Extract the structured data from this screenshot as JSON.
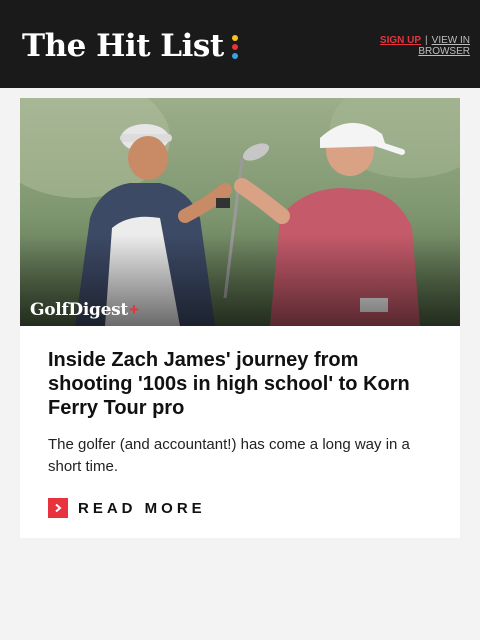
{
  "header": {
    "logo_text": "The Hit List",
    "logo_dot_colors": [
      "#f5c518",
      "#e8333e",
      "#3aa0e8"
    ],
    "signup_label": "SIGN UP",
    "separator": "|",
    "view_in_browser_label": "VIEW IN BROWSER"
  },
  "article": {
    "image_alt": "Golfer and caddie fist-bumping on the course",
    "image_brand": "GolfDigest",
    "image_brand_plus": "+",
    "headline": "Inside Zach James' journey from shooting '100s in high school' to Korn Ferry Tour pro",
    "summary": "The golfer (and accountant!) has come a long way in a short time.",
    "cta_icon": "chevron-right-icon",
    "cta_label": "READ MORE"
  },
  "colors": {
    "header_bg": "#1a1a1a",
    "accent_red": "#e8333e",
    "page_bg": "#f3f3f3"
  }
}
